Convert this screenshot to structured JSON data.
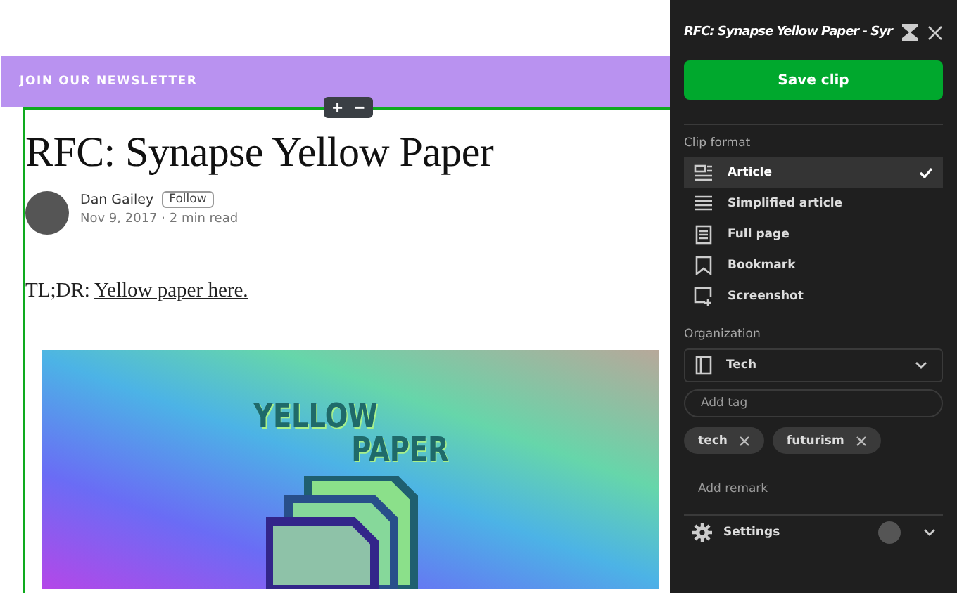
{
  "page": {
    "newsletter": "JOIN OUR NEWSLETTER",
    "article": {
      "title": "RFC: Synapse Yellow Paper",
      "author": "Dan Gailey",
      "follow": "Follow",
      "meta": "Nov 9, 2017 · 2 min read",
      "tldr": "TL;DR:",
      "link": "Yellow paper here.",
      "image_text": [
        "YELLOW",
        "PAPER"
      ]
    },
    "zoom_controls": [
      "+",
      "−"
    ]
  },
  "clipper": {
    "title": "RFC: Synapse Yellow Paper - Syr",
    "save": "Save clip",
    "format_label": "Clip format",
    "formats": [
      {
        "label": "Article",
        "kind": "article",
        "selected": true
      },
      {
        "label": "Simplified article",
        "kind": "simplified",
        "selected": false
      },
      {
        "label": "Full page",
        "kind": "full",
        "selected": false
      },
      {
        "label": "Bookmark",
        "kind": "bookmark",
        "selected": false
      },
      {
        "label": "Screenshot",
        "kind": "screenshot",
        "selected": false
      }
    ],
    "organization_label": "Organization",
    "notebook": "Tech",
    "tag_placeholder": "Add tag",
    "tags": [
      "tech",
      "futurism"
    ],
    "remark_placeholder": "Add remark",
    "settings": "Settings"
  }
}
